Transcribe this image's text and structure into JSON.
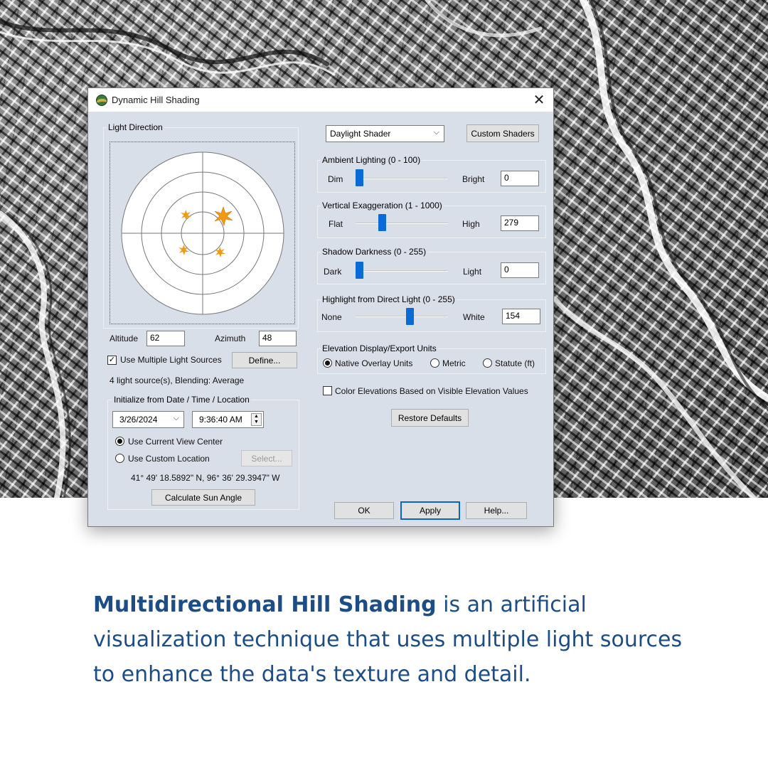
{
  "window": {
    "title": "Dynamic Hill Shading",
    "close_glyph": "✕"
  },
  "light_direction": {
    "group_label": "Light Direction",
    "altitude_label": "Altitude",
    "altitude_value": "62",
    "azimuth_label": "Azimuth",
    "azimuth_value": "48",
    "use_multiple_label": "Use Multiple Light Sources",
    "use_multiple_checked": true,
    "define_button": "Define...",
    "light_summary": "4 light source(s), Blending: Average",
    "sun_color": "#f29a12"
  },
  "initialize": {
    "group_label": "Initialize from Date / Time / Location",
    "date_value": "3/26/2024",
    "time_value": "9:36:40 AM",
    "use_view_center_label": "Use Current View Center",
    "use_custom_location_label": "Use Custom Location",
    "select_button": "Select...",
    "coordinates": "41° 49' 18.5892\" N, 96° 36' 29.3947\" W",
    "calculate_button": "Calculate Sun Angle"
  },
  "shader": {
    "selected": "Daylight Shader",
    "custom_shaders_button": "Custom Shaders"
  },
  "ambient": {
    "group_label": "Ambient Lighting (0 - 100)",
    "min_label": "Dim",
    "max_label": "Bright",
    "value": "0",
    "level": 0
  },
  "exaggeration": {
    "group_label": "Vertical Exaggeration (1 - 1000)",
    "min_label": "Flat",
    "max_label": "High",
    "value": "279",
    "level": 0.27
  },
  "shadow": {
    "group_label": "Shadow Darkness (0 - 255)",
    "min_label": "Dark",
    "max_label": "Light",
    "value": "0",
    "level": 0
  },
  "highlight": {
    "group_label": "Highlight from Direct Light (0 - 255)",
    "min_label": "None",
    "max_label": "White",
    "value": "154",
    "level": 0.6
  },
  "units": {
    "group_label": "Elevation Display/Export Units",
    "options": [
      "Native Overlay Units",
      "Metric",
      "Statute (ft)"
    ],
    "selected_index": 0
  },
  "color_elevations_label": "Color Elevations Based on Visible Elevation Values",
  "color_elevations_checked": false,
  "restore_defaults_button": "Restore Defaults",
  "footer": {
    "ok": "OK",
    "apply": "Apply",
    "help": "Help..."
  },
  "caption": {
    "bold": "Multidirectional Hill Shading",
    "rest": " is an artificial visualization technique that uses multiple light sources to enhance the data's texture and detail.",
    "color": "#1d4d86"
  }
}
